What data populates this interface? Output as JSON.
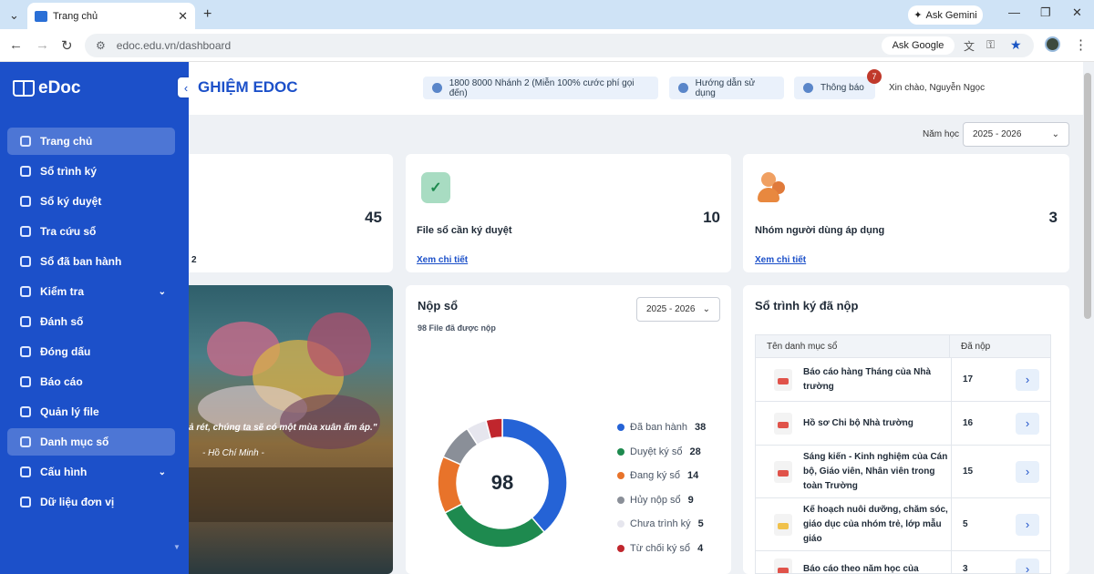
{
  "browser": {
    "tab_title": "Trang chủ",
    "url": "edoc.edu.vn/dashboard",
    "ask_gemini": "Ask Gemini",
    "ask_google": "Ask Google"
  },
  "sidebar": {
    "logo": "eDoc",
    "items": [
      {
        "label": "Trang chủ"
      },
      {
        "label": "Sổ trình ký"
      },
      {
        "label": "Sổ ký duyệt"
      },
      {
        "label": "Tra cứu sổ"
      },
      {
        "label": "Sổ đã ban hành"
      },
      {
        "label": "Kiểm tra"
      },
      {
        "label": "Đánh số"
      },
      {
        "label": "Đóng dấu"
      },
      {
        "label": "Báo cáo"
      },
      {
        "label": "Quản lý file"
      },
      {
        "label": "Danh mục sổ"
      },
      {
        "label": "Cấu hình"
      },
      {
        "label": "Dữ liệu đơn vị"
      }
    ]
  },
  "header": {
    "title": "GHIỆM EDOC",
    "hotline": "1800 8000 Nhánh 2 (Miễn 100% cước phí gọi đến)",
    "guide": "Hướng dẫn sử dụng",
    "notify": "Thông báo",
    "notify_count": "7",
    "greeting": "Xin chào, Nguyễn Ngọc"
  },
  "filter": {
    "year_label": "Năm học",
    "year_value": "2025 - 2026"
  },
  "cards": [
    {
      "number": "45",
      "label_partial": "2"
    },
    {
      "number": "10",
      "label": "File sổ cần ký duyệt",
      "link": "Xem chi tiết"
    },
    {
      "number": "3",
      "label": "Nhóm người dùng áp dụng",
      "link": "Xem chi tiết"
    }
  ],
  "banner": {
    "quote": "ả rét, chúng ta sẽ có một mùa xuân ấm áp.\"",
    "author": "- Hồ Chí Minh -"
  },
  "nop_so": {
    "title": "Nộp sổ",
    "subtitle": "98 File đã được nộp",
    "year_value": "2025 - 2026",
    "total": "98"
  },
  "chart_data": {
    "type": "pie",
    "donut": true,
    "center_label": "98",
    "categories": [
      "Đã ban hành",
      "Duyệt ký sổ",
      "Đang ký sổ",
      "Hủy nộp sổ",
      "Chưa trình ký",
      "Từ chối ký sổ"
    ],
    "values": [
      38,
      28,
      14,
      9,
      5,
      4
    ],
    "colors": [
      "#2563d6",
      "#1e8a4f",
      "#e8732a",
      "#8a8f98",
      "#e6e6ee",
      "#c0262d"
    ],
    "legend": "right"
  },
  "submitted": {
    "title": "Sổ trình ký đã nộp",
    "col_name": "Tên danh mục sổ",
    "col_count": "Đã nộp",
    "rows": [
      {
        "name": "Báo cáo hàng Tháng của Nhà trường",
        "count": "17",
        "icon": "red"
      },
      {
        "name": "Hồ sơ Chi bộ Nhà trường",
        "count": "16",
        "icon": "red"
      },
      {
        "name": "Sáng kiến - Kinh nghiệm của Cán bộ, Giáo viên, Nhân viên trong toàn Trường",
        "count": "15",
        "icon": "red"
      },
      {
        "name": "Kế hoạch nuôi dưỡng, chăm sóc, giáo dục của nhóm trẻ, lớp mẫu giáo",
        "count": "5",
        "icon": "yellow"
      },
      {
        "name": "Báo cáo theo năm học của",
        "count": "3",
        "icon": "red"
      }
    ]
  }
}
